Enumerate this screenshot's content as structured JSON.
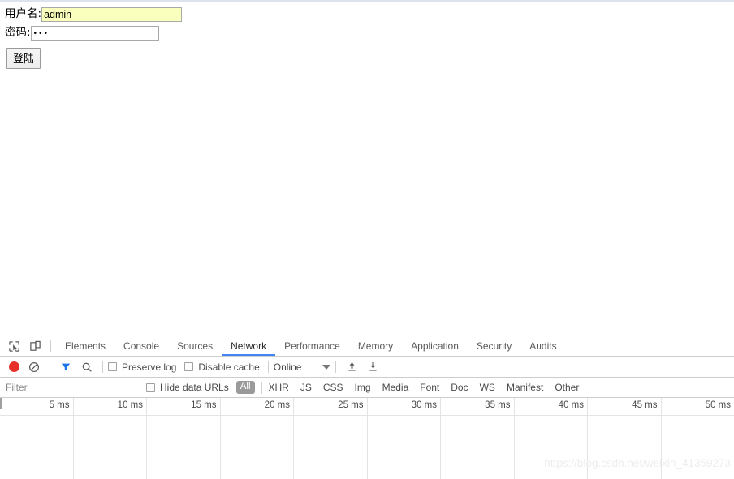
{
  "page": {
    "form": {
      "username_label": "用户名:",
      "username_value": "admin",
      "password_label": "密码:",
      "password_value": "•••",
      "submit_label": "登陆"
    }
  },
  "devtools": {
    "icons": {
      "inspect": "inspect-element-icon",
      "device": "device-toolbar-icon",
      "record": "record-icon",
      "clear": "clear-icon",
      "filter": "filter-funnel-icon",
      "search": "search-icon",
      "import": "import-har-icon",
      "export": "export-har-icon"
    },
    "tabs": [
      {
        "label": "Elements",
        "active": false
      },
      {
        "label": "Console",
        "active": false
      },
      {
        "label": "Sources",
        "active": false
      },
      {
        "label": "Network",
        "active": true
      },
      {
        "label": "Performance",
        "active": false
      },
      {
        "label": "Memory",
        "active": false
      },
      {
        "label": "Application",
        "active": false
      },
      {
        "label": "Security",
        "active": false
      },
      {
        "label": "Audits",
        "active": false
      }
    ],
    "toolbar": {
      "preserve_log_label": "Preserve log",
      "preserve_log_checked": false,
      "disable_cache_label": "Disable cache",
      "disable_cache_checked": false,
      "throttling_value": "Online"
    },
    "filterbar": {
      "filter_placeholder": "Filter",
      "filter_value": "",
      "hide_data_urls_label": "Hide data URLs",
      "hide_data_urls_checked": false,
      "selected_type": "All",
      "types": [
        "XHR",
        "JS",
        "CSS",
        "Img",
        "Media",
        "Font",
        "Doc",
        "WS",
        "Manifest",
        "Other"
      ]
    },
    "timeline": {
      "ticks": [
        "5 ms",
        "10 ms",
        "15 ms",
        "20 ms",
        "25 ms",
        "30 ms",
        "35 ms",
        "40 ms",
        "45 ms",
        "50 ms"
      ]
    },
    "watermark": "https://blog.csdn.net/weixin_41359273"
  },
  "colors": {
    "accent": "#4285f4",
    "record": "#e8302a",
    "autofill": "#faffbd",
    "filter_active": "#1a73e8"
  }
}
